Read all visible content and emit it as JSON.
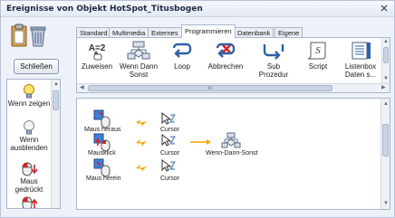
{
  "window": {
    "title": "Ereignisse von Objekt HotSpot_Titusbogen"
  },
  "left": {
    "close_label": "Schließen",
    "palette": [
      {
        "icon": "lightbulb-on-icon",
        "label": "Wenn zeigen"
      },
      {
        "icon": "lightbulb-off-icon",
        "label": "Wenn ausblenden"
      },
      {
        "icon": "mouse-pressed-icon",
        "label": "Maus gedrückt"
      }
    ]
  },
  "tabs": [
    {
      "label": "Standard",
      "active": false
    },
    {
      "label": "Multimedia",
      "active": false
    },
    {
      "label": "Externes",
      "active": false
    },
    {
      "label": "Programmieren",
      "active": true
    },
    {
      "label": "Datenbank",
      "active": false
    },
    {
      "label": "Eigene",
      "active": false
    }
  ],
  "ribbon": {
    "items": [
      {
        "icon": "assign-icon",
        "label": "Zuweisen",
        "icon_text": "A=2"
      },
      {
        "icon": "if-then-else-icon",
        "label": "Wenn Dann Sonst"
      },
      {
        "icon": "loop-icon",
        "label": "Loop"
      },
      {
        "icon": "cancel-icon",
        "label": "Abbrechen"
      },
      {
        "icon": "sub-procedure-icon",
        "label": "Sub Prozedur"
      },
      {
        "icon": "script-icon",
        "label": "Script",
        "icon_text": "S"
      },
      {
        "icon": "listbox-data-icon",
        "label": "Listenbox Daten s..."
      }
    ],
    "hscroll_grip": "III"
  },
  "canvas": {
    "rows": [
      {
        "event": "Maus heraus",
        "cursor": "Cursor"
      },
      {
        "event": "Mausklick",
        "cursor": "Cursor",
        "next": "Wenn-Dann-Sonst"
      },
      {
        "event": "Maus herein",
        "cursor": "Cursor"
      }
    ]
  },
  "colors": {
    "accent": "#f5a300",
    "tab_border": "#a9b6cb",
    "mouse_red": "#d4242a"
  }
}
